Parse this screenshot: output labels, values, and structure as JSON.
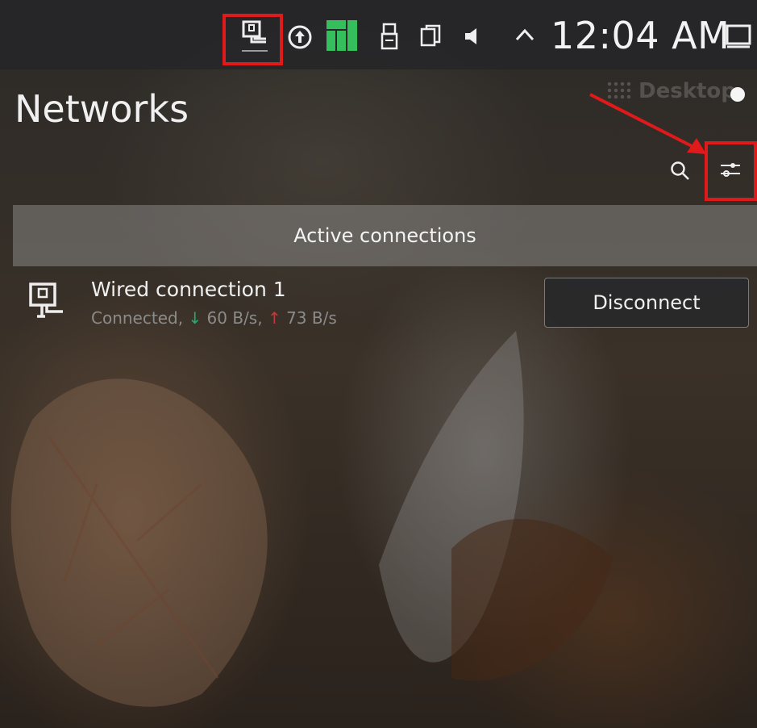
{
  "panel": {
    "clock": "12:04 AM",
    "tray_icons": [
      "network-wired-icon",
      "update-icon",
      "manjaro-icon",
      "usb-icon",
      "clipboard-icon",
      "volume-icon",
      "expand-tray-icon",
      "show-desktop-icon"
    ]
  },
  "desktop_label": "Desktop",
  "networks": {
    "title": "Networks",
    "section_header": "Active connections",
    "connection": {
      "name": "Wired connection 1",
      "status": "Connected,",
      "download_arrow": "↓",
      "download": " 60 B/s,",
      "upload_arrow": "↑",
      "upload": " 73 B/s",
      "action": "Disconnect"
    }
  },
  "colors": {
    "highlight": "#e0191b",
    "manjaro_green": "#35bf5c",
    "download": "#2aa86a",
    "upload": "#c23a3a"
  }
}
